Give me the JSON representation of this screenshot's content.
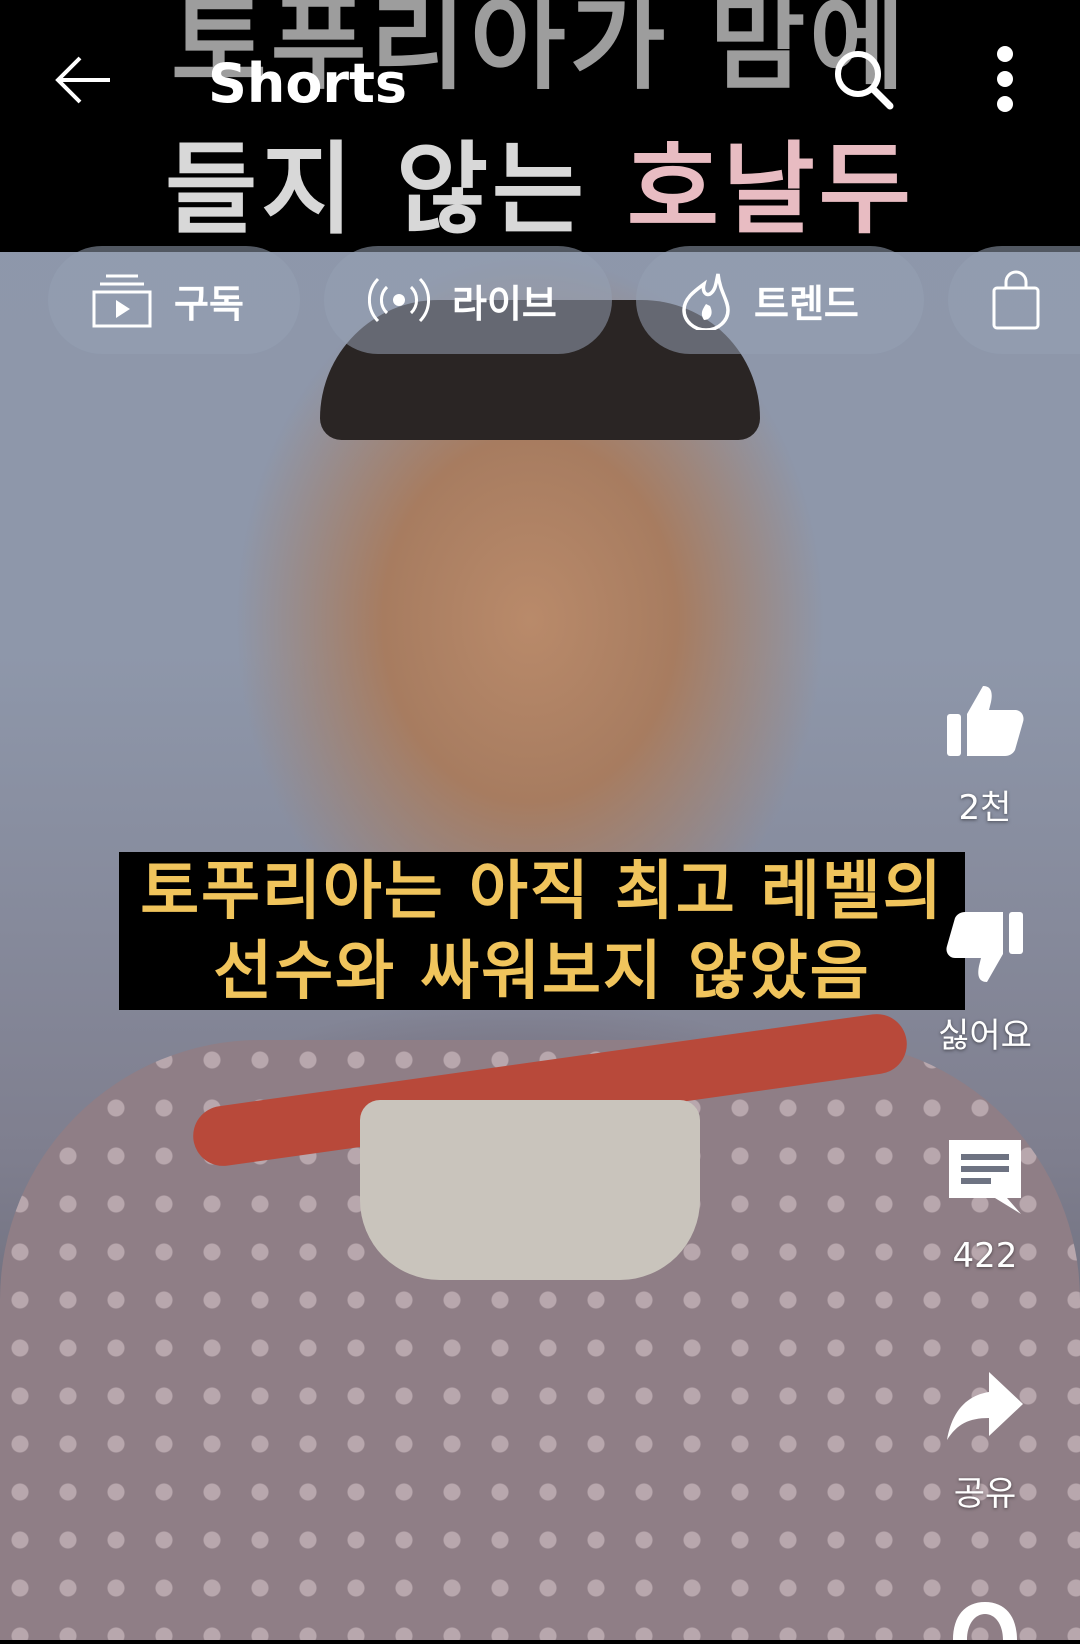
{
  "app_title": "Shorts",
  "video": {
    "banner_line1": "토푸리아가 맘에",
    "banner_line2_a": "들지 않는 ",
    "banner_line2_b": "호날두",
    "subtitle_line1": "토푸리아는 아직 최고 레벨의",
    "subtitle_line2": "선수와 싸워보지 않았음"
  },
  "chips": [
    {
      "label": "구독",
      "icon": "subscriptions-icon"
    },
    {
      "label": "라이브",
      "icon": "live-icon"
    },
    {
      "label": "트렌드",
      "icon": "trending-icon"
    },
    {
      "label": "",
      "icon": "shopping-bag-icon"
    }
  ],
  "actions": {
    "like_count": "2천",
    "dislike_label": "싫어요",
    "comment_count": "422",
    "share_label": "공유"
  },
  "colors": {
    "subtitle_text": "#f0c45c",
    "banner_highlight": "#e8bcc2",
    "chip_bg": "rgba(150,160,178,0.55)"
  }
}
